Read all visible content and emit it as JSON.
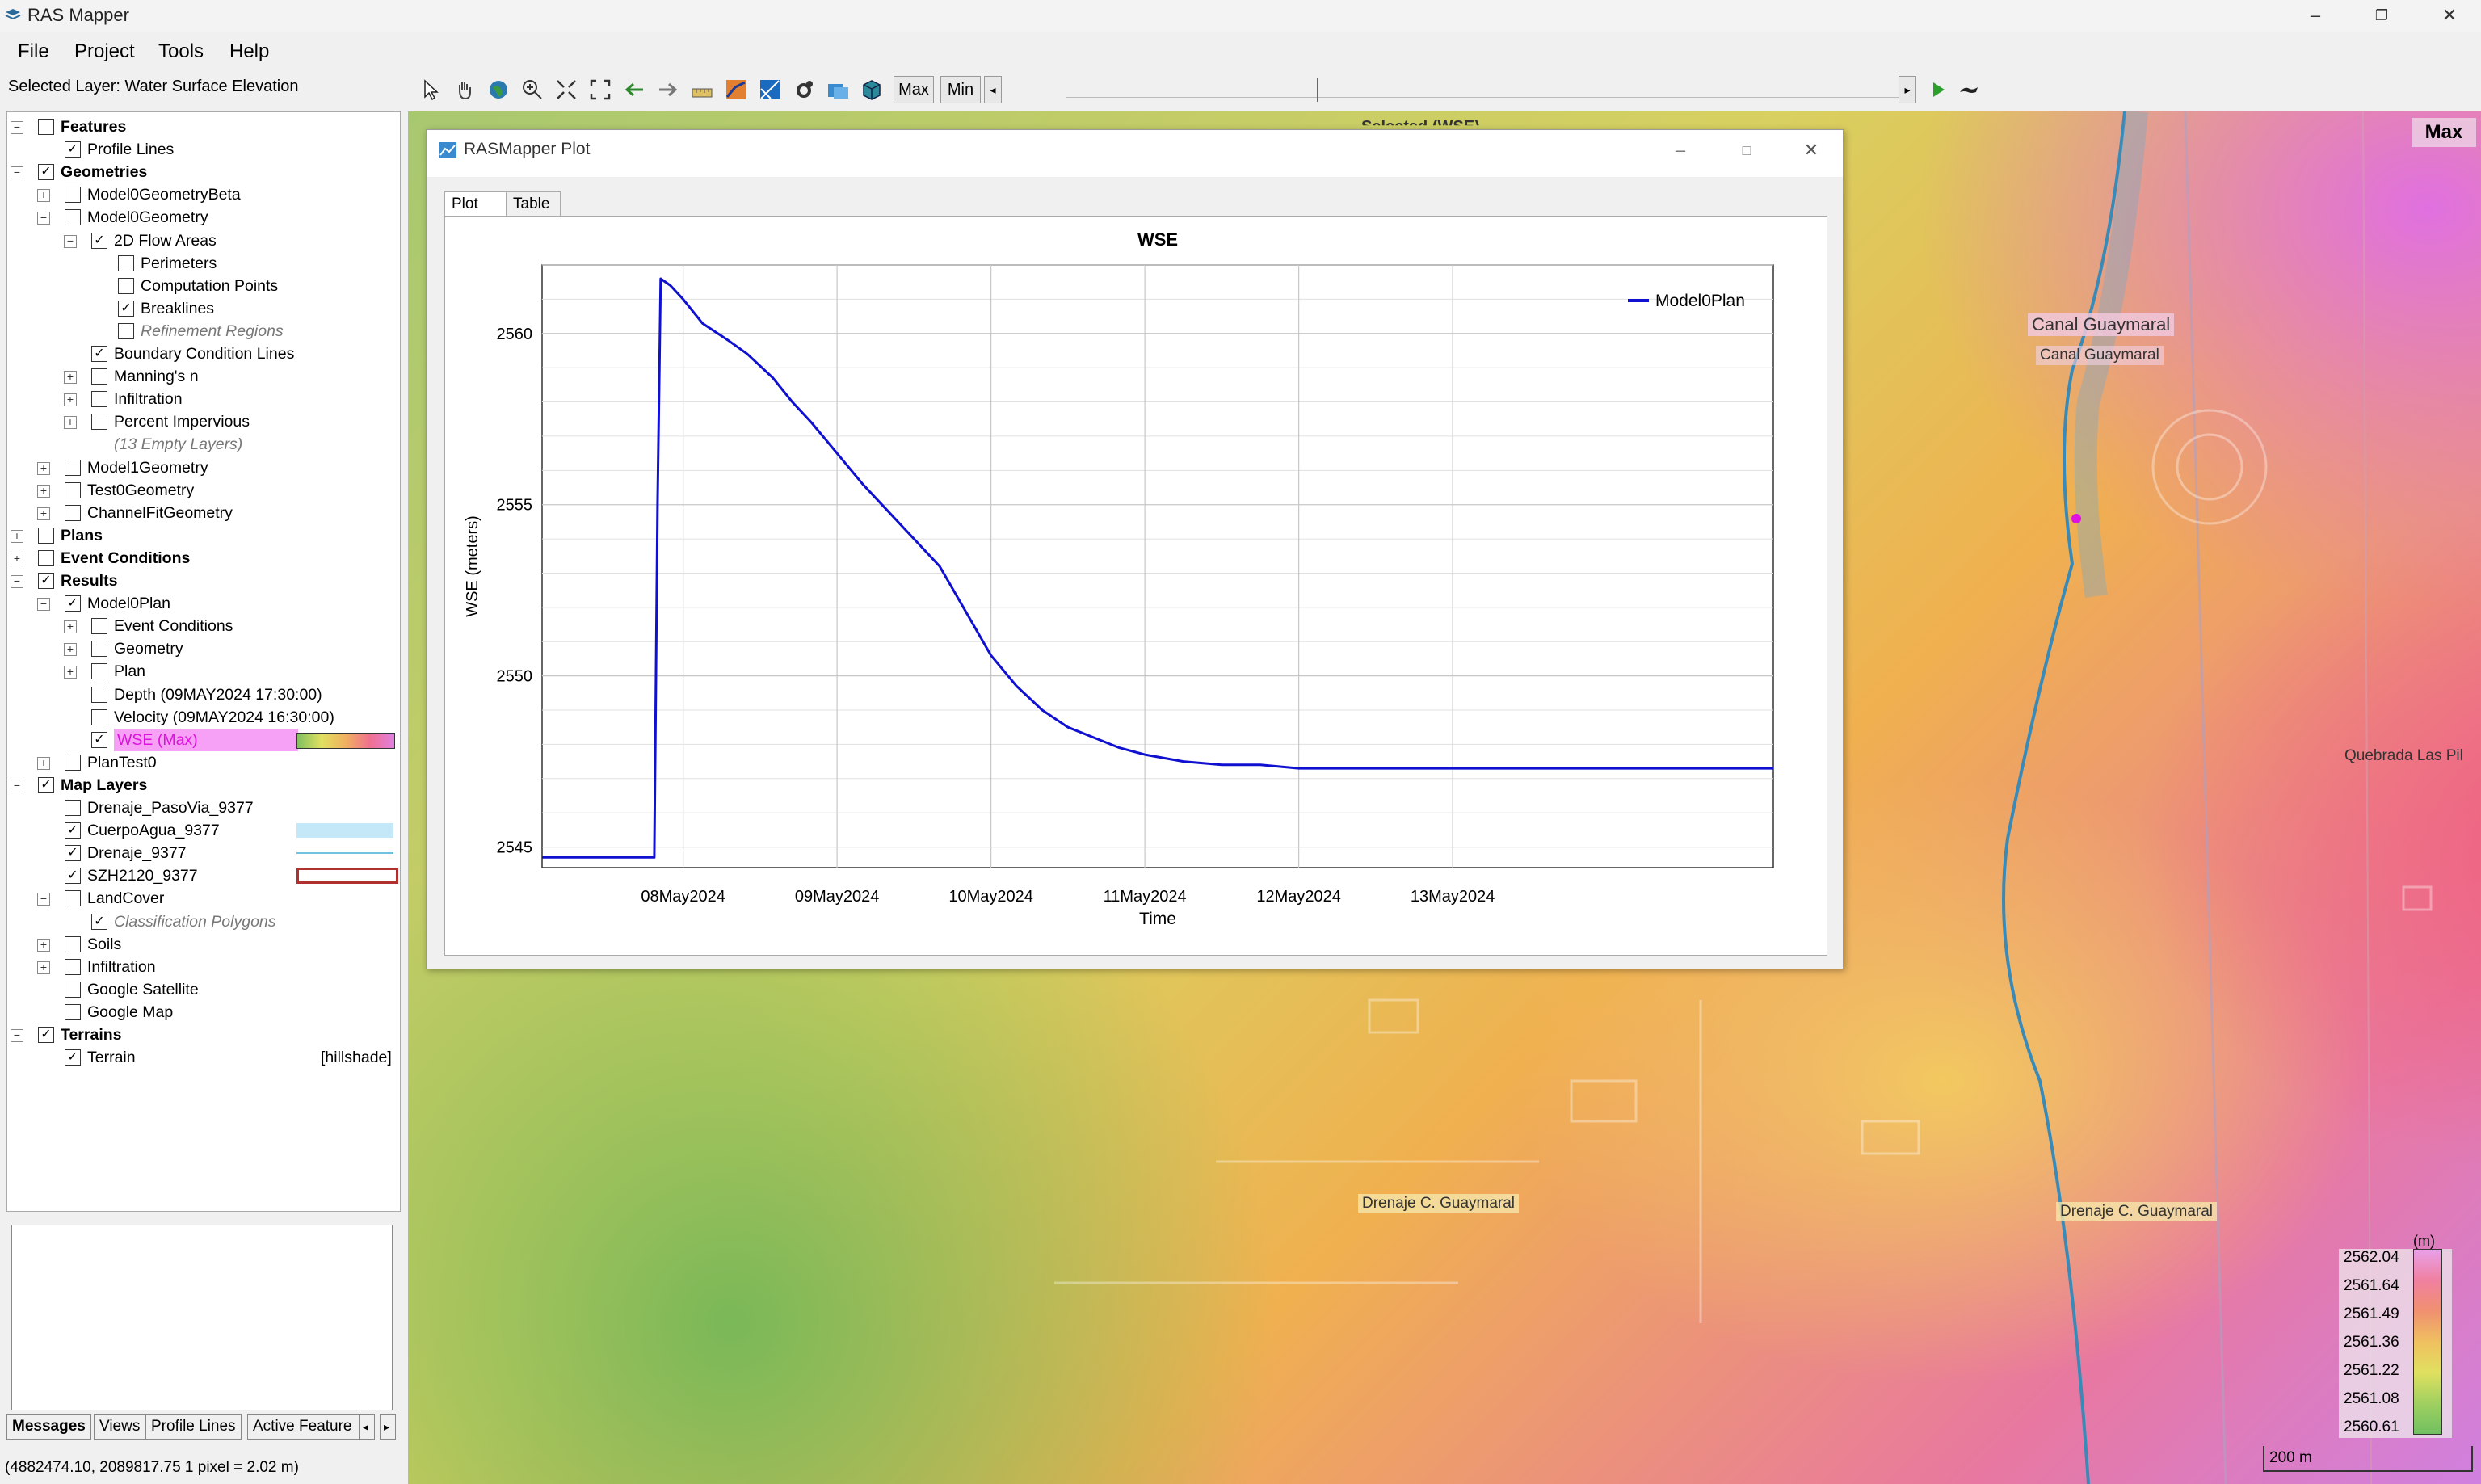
{
  "window": {
    "title": "RAS Mapper",
    "menu": [
      "File",
      "Project",
      "Tools",
      "Help"
    ]
  },
  "toolbar": {
    "selected_layer": "Selected Layer: Water Surface Elevation",
    "max_label": "Max",
    "min_label": "Min"
  },
  "tree": [
    {
      "label": "Features",
      "level": 0,
      "exp": "-",
      "check": false,
      "style": "bold"
    },
    {
      "label": "Profile Lines",
      "level": 1,
      "exp": "",
      "check": true,
      "style": ""
    },
    {
      "label": "Geometries",
      "level": 0,
      "exp": "-",
      "check": true,
      "style": "bold"
    },
    {
      "label": "Model0GeometryBeta",
      "level": 1,
      "exp": "+",
      "check": false,
      "style": ""
    },
    {
      "label": "Model0Geometry",
      "level": 1,
      "exp": "-",
      "check": false,
      "style": ""
    },
    {
      "label": "2D Flow Areas",
      "level": 2,
      "exp": "-",
      "check": true,
      "style": ""
    },
    {
      "label": "Perimeters",
      "level": 3,
      "exp": "",
      "check": false,
      "style": ""
    },
    {
      "label": "Computation Points",
      "level": 3,
      "exp": "",
      "check": false,
      "style": ""
    },
    {
      "label": "Breaklines",
      "level": 3,
      "exp": "",
      "check": true,
      "style": ""
    },
    {
      "label": "Refinement Regions",
      "level": 3,
      "exp": "",
      "check": false,
      "style": "italic"
    },
    {
      "label": "Boundary Condition Lines",
      "level": 2,
      "exp": "",
      "check": true,
      "style": ""
    },
    {
      "label": "Manning's n",
      "level": 2,
      "exp": "+",
      "check": false,
      "style": ""
    },
    {
      "label": "Infiltration",
      "level": 2,
      "exp": "+",
      "check": false,
      "style": ""
    },
    {
      "label": "Percent Impervious",
      "level": 2,
      "exp": "+",
      "check": false,
      "style": ""
    },
    {
      "label": "(13 Empty Layers)",
      "level": 2,
      "exp": "",
      "check": null,
      "style": "italic"
    },
    {
      "label": "Model1Geometry",
      "level": 1,
      "exp": "+",
      "check": false,
      "style": ""
    },
    {
      "label": "Test0Geometry",
      "level": 1,
      "exp": "+",
      "check": false,
      "style": ""
    },
    {
      "label": "ChannelFitGeometry",
      "level": 1,
      "exp": "+",
      "check": false,
      "style": ""
    },
    {
      "label": "Plans",
      "level": 0,
      "exp": "+",
      "check": false,
      "style": "bold"
    },
    {
      "label": "Event Conditions",
      "level": 0,
      "exp": "+",
      "check": false,
      "style": "bold"
    },
    {
      "label": "Results",
      "level": 0,
      "exp": "-",
      "check": true,
      "style": "bold"
    },
    {
      "label": "Model0Plan",
      "level": 1,
      "exp": "-",
      "check": true,
      "style": ""
    },
    {
      "label": "Event Conditions",
      "level": 2,
      "exp": "+",
      "check": false,
      "style": ""
    },
    {
      "label": "Geometry",
      "level": 2,
      "exp": "+",
      "check": false,
      "style": ""
    },
    {
      "label": "Plan",
      "level": 2,
      "exp": "+",
      "check": false,
      "style": ""
    },
    {
      "label": "Depth (09MAY2024 17:30:00)",
      "level": 2,
      "exp": "",
      "check": false,
      "style": ""
    },
    {
      "label": "Velocity (09MAY2024 16:30:00)",
      "level": 2,
      "exp": "",
      "check": false,
      "style": ""
    },
    {
      "label": "WSE (Max)",
      "level": 2,
      "exp": "",
      "check": true,
      "style": "selected",
      "swatch": "gradient"
    },
    {
      "label": "PlanTest0",
      "level": 1,
      "exp": "+",
      "check": false,
      "style": ""
    },
    {
      "label": "Map Layers",
      "level": 0,
      "exp": "-",
      "check": true,
      "style": "bold"
    },
    {
      "label": "Drenaje_PasoVia_9377",
      "level": 1,
      "exp": "",
      "check": false,
      "style": ""
    },
    {
      "label": "CuerpoAgua_9377",
      "level": 1,
      "exp": "",
      "check": true,
      "style": "",
      "swatch": "water"
    },
    {
      "label": "Drenaje_9377",
      "level": 1,
      "exp": "",
      "check": true,
      "style": "",
      "swatch": "line"
    },
    {
      "label": "SZH2120_9377",
      "level": 1,
      "exp": "",
      "check": true,
      "style": "",
      "swatch": "red"
    },
    {
      "label": "LandCover",
      "level": 1,
      "exp": "-",
      "check": false,
      "style": ""
    },
    {
      "label": "Classification Polygons",
      "level": 2,
      "exp": "",
      "check": true,
      "style": "italic"
    },
    {
      "label": "Soils",
      "level": 1,
      "exp": "+",
      "check": false,
      "style": ""
    },
    {
      "label": "Infiltration",
      "level": 1,
      "exp": "+",
      "check": false,
      "style": ""
    },
    {
      "label": "Google Satellite",
      "level": 1,
      "exp": "",
      "check": false,
      "style": ""
    },
    {
      "label": "Google Map",
      "level": 1,
      "exp": "",
      "check": false,
      "style": ""
    },
    {
      "label": "Terrains",
      "level": 0,
      "exp": "-",
      "check": true,
      "style": "bold"
    },
    {
      "label": "Terrain",
      "level": 1,
      "exp": "",
      "check": true,
      "style": "",
      "suffix": "[hillshade]"
    }
  ],
  "bottom_tabs": [
    "Messages",
    "Views",
    "Profile Lines",
    "Active Feature"
  ],
  "status": "(4882474.10, 2089817.75  1 pixel = 2.02 m)",
  "map": {
    "corner_label": "Max",
    "top_partial_label": "Selected (WSE)",
    "labels": [
      {
        "text": "Canal Guaymaral",
        "style": "pink",
        "k": "canal1"
      },
      {
        "text": "Canal Guaymaral",
        "style": "plain",
        "k": "canal2"
      },
      {
        "text": "Quebrada Las Pil",
        "style": "plain",
        "k": "quebrada"
      },
      {
        "text": "Drenaje C. Guaymaral",
        "style": "pink",
        "k": "drenaje1"
      },
      {
        "text": "Drenaje C. Guaymaral",
        "style": "pink",
        "k": "drenaje2"
      }
    ],
    "legend": {
      "unit": "(m)",
      "values": [
        "2562.04",
        "2561.64",
        "2561.49",
        "2561.36",
        "2561.22",
        "2561.08",
        "2560.61"
      ],
      "colors": [
        "#e8a0e8",
        "#f080a0",
        "#f09070",
        "#f0c060",
        "#e0e060",
        "#a0d060",
        "#70c060"
      ]
    },
    "scale": "200 m"
  },
  "plot_window": {
    "title": "RASMapper Plot",
    "tabs": [
      "Plot",
      "Table"
    ]
  },
  "chart_data": {
    "type": "line",
    "title": "WSE",
    "xlabel": "Time",
    "ylabel": "WSE (meters)",
    "x_ticks": [
      "08May2024",
      "09May2024",
      "10May2024",
      "11May2024",
      "12May2024",
      "13May2024"
    ],
    "y_ticks": [
      2545,
      2550,
      2555,
      2560
    ],
    "ylim": [
      2544.4,
      2562.0
    ],
    "xlim_hours": [
      -22,
      170
    ],
    "grid": true,
    "legend_position": "top-right",
    "series": [
      {
        "name": "Model0Plan",
        "color": "#1010d0",
        "points_hours": [
          -22,
          -4.5,
          -4,
          -3.5,
          -2,
          0,
          3,
          7,
          10,
          14,
          17,
          20,
          24,
          28,
          32,
          36,
          40,
          44,
          48,
          52,
          56,
          60,
          64,
          68,
          72,
          78,
          84,
          90,
          96,
          102,
          110,
          120,
          130,
          150,
          170
        ],
        "values": [
          2544.7,
          2544.7,
          2555,
          2561.6,
          2561.4,
          2561.0,
          2560.3,
          2559.8,
          2559.4,
          2558.7,
          2558.0,
          2557.4,
          2556.5,
          2555.6,
          2554.8,
          2554.0,
          2553.2,
          2551.9,
          2550.6,
          2549.7,
          2549.0,
          2548.5,
          2548.2,
          2547.9,
          2547.7,
          2547.5,
          2547.4,
          2547.4,
          2547.3,
          2547.3,
          2547.3,
          2547.3,
          2547.3,
          2547.3,
          2547.3
        ]
      }
    ]
  }
}
